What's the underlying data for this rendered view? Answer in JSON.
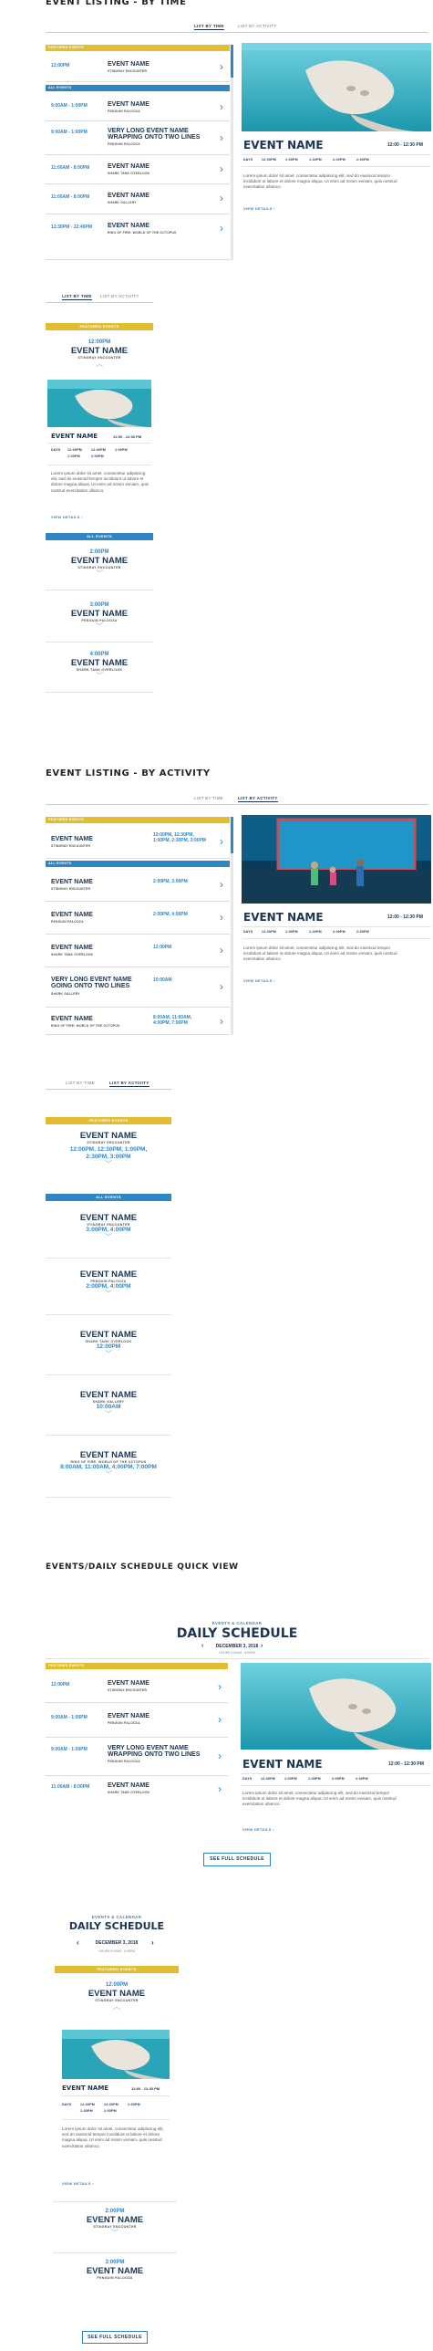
{
  "sections": {
    "by_time": "EVENT LISTING - BY TIME",
    "by_activity": "EVENT LISTING - BY ACTIVITY",
    "quick_view": "EVENTS/DAILY SCHEDULE QUICK VIEW"
  },
  "tabs": {
    "by_time": "LIST BY TIME",
    "by_activity": "LIST BY ACTIVITY"
  },
  "labels": {
    "featured": "FEATURED EVENTS",
    "all": "ALL EVENTS",
    "view_details": "VIEW DETAILS",
    "see_full": "SEE FULL SCHEDULE"
  },
  "detail": {
    "name": "EVENT NAME",
    "time": "12:00 - 12:30 PM",
    "days_label": "DAYS",
    "days": [
      "12:30PM",
      "1:00PM",
      "1:30PM",
      "2:00PM",
      "2:30PM"
    ],
    "text": "Lorem ipsum dolor sit amet, consectetur adipiscing elit, sed do eiusmod tempor incididunt ut labore et dolore magna aliqua. Ut enim ad minim veniam, quis nostrud exercitation ullamco."
  },
  "time_list": {
    "featured": [
      {
        "time": "12:00PM",
        "name": "EVENT NAME",
        "sub": "STINGRAY ENCOUNTER"
      }
    ],
    "all": [
      {
        "time": "9:00AM - 1:00PM",
        "name": "EVENT NAME",
        "sub": "PENGUIN PALOOZA"
      },
      {
        "time": "9:00AM - 1:00PM",
        "name": "VERY LONG EVENT NAME WRAPPING ONTO TWO LINES",
        "sub": "PENGUIN PALOOZA"
      },
      {
        "time": "11:00AM - 8:00PM",
        "name": "EVENT NAME",
        "sub": "SHARK TANK OVERLOOK"
      },
      {
        "time": "11:00AM - 8:00PM",
        "name": "EVENT NAME",
        "sub": "SHARK GALLERY"
      },
      {
        "time": "12:30PM - 12:40PM",
        "name": "EVENT NAME",
        "sub": "RING OF FIRE: WORLD OF THE OCTOPUS"
      }
    ]
  },
  "activity_list": {
    "featured": [
      {
        "time": "12:00PM, 12:30PM, 1:00PM, 2:30PM, 3:00PM",
        "name": "EVENT NAME",
        "sub": "STINGRAY ENCOUNTER"
      }
    ],
    "all": [
      {
        "time": "2:00PM, 3:00PM",
        "name": "EVENT NAME",
        "sub": "STINGRAY ENCOUNTER"
      },
      {
        "time": "2:00PM, 4:00PM",
        "name": "EVENT NAME",
        "sub": "PENGUIN PALOOZA"
      },
      {
        "time": "12:00PM",
        "name": "EVENT NAME",
        "sub": "SHARK TANK OVERLOOK"
      },
      {
        "time": "10:00AM",
        "name": "VERY LONG EVENT NAME GOING ONTO TWO LINES",
        "sub": "SHARK GALLERY"
      },
      {
        "time": "8:00AM, 11:00AM, 4:00PM, 7:00PM",
        "name": "EVENT NAME",
        "sub": "RING OF FIRE: WORLD OF THE OCTOPUS"
      }
    ]
  },
  "mobile_time": {
    "featured": {
      "time": "12:00PM",
      "name": "EVENT NAME",
      "sub": "STINGRAY ENCOUNTER"
    },
    "detail_days": [
      "12:00PM",
      "12:30PM",
      "1:00PM",
      "1:30PM",
      "2:00PM"
    ],
    "all": [
      {
        "time": "2:00PM",
        "name": "EVENT NAME",
        "sub": "STINGRAY ENCOUNTER"
      },
      {
        "time": "3:00PM",
        "name": "EVENT NAME",
        "sub": "PENGUIN PALOOZA"
      },
      {
        "time": "4:00PM",
        "name": "EVENT NAME",
        "sub": "SHARK TANK OVERLOOK"
      }
    ]
  },
  "mobile_activity": {
    "featured": {
      "name": "EVENT NAME",
      "sub": "STINGRAY ENCOUNTER",
      "times": "12:00PM, 12:30PM, 1:00PM, 2:30PM, 3:00PM"
    },
    "all": [
      {
        "name": "EVENT NAME",
        "sub": "STINGRAY ENCOUNTER",
        "times": "3:00PM, 4:00PM"
      },
      {
        "name": "EVENT NAME",
        "sub": "PENGUIN PALOOZA",
        "times": "2:00PM, 4:00PM"
      },
      {
        "name": "EVENT NAME",
        "sub": "SHARK TANK OVERLOOK",
        "times": "12:00PM"
      },
      {
        "name": "EVENT NAME",
        "sub": "SHARK GALLERY",
        "times": "10:00AM"
      },
      {
        "name": "EVENT NAME",
        "sub": "RING OF FIRE: WORLD OF THE OCTOPUS",
        "times": "8:00AM, 11:00AM, 4:00PM, 7:00PM"
      }
    ]
  },
  "daily": {
    "eyebrow": "EVENTS & CALENDAR",
    "title": "DAILY SCHEDULE",
    "date": "DECEMBER 3, 2018",
    "hours": "HOURS 9:00AM - 6:00PM",
    "list": [
      {
        "time": "12:00PM",
        "name": "EVENT NAME",
        "sub": "STINGRAY ENCOUNTER"
      },
      {
        "time": "9:00AM - 1:00PM",
        "name": "EVENT NAME",
        "sub": "PENGUIN PALOOZA"
      },
      {
        "time": "9:00AM - 1:00PM",
        "name": "VERY LONG EVENT NAME WRAPPING ONTO TWO LINES",
        "sub": "PENGUIN PALOOZA"
      },
      {
        "time": "11:00AM - 8:00PM",
        "name": "EVENT NAME",
        "sub": "SHARK TANK OVERLOOK"
      }
    ],
    "mobile": [
      {
        "time": "2:00PM",
        "name": "EVENT NAME",
        "sub": "STINGRAY ENCOUNTER"
      },
      {
        "time": "3:00PM",
        "name": "EVENT NAME",
        "sub": "PENGUIN PALOOZA"
      },
      {
        "time": "4:00PM",
        "name": "EVENT NAME",
        "sub": "SHARK TANK OVERLOOK"
      }
    ]
  },
  "colors": {
    "blue": "#2f86c4",
    "navy": "#1b3552",
    "yellow": "#e2bd30"
  }
}
